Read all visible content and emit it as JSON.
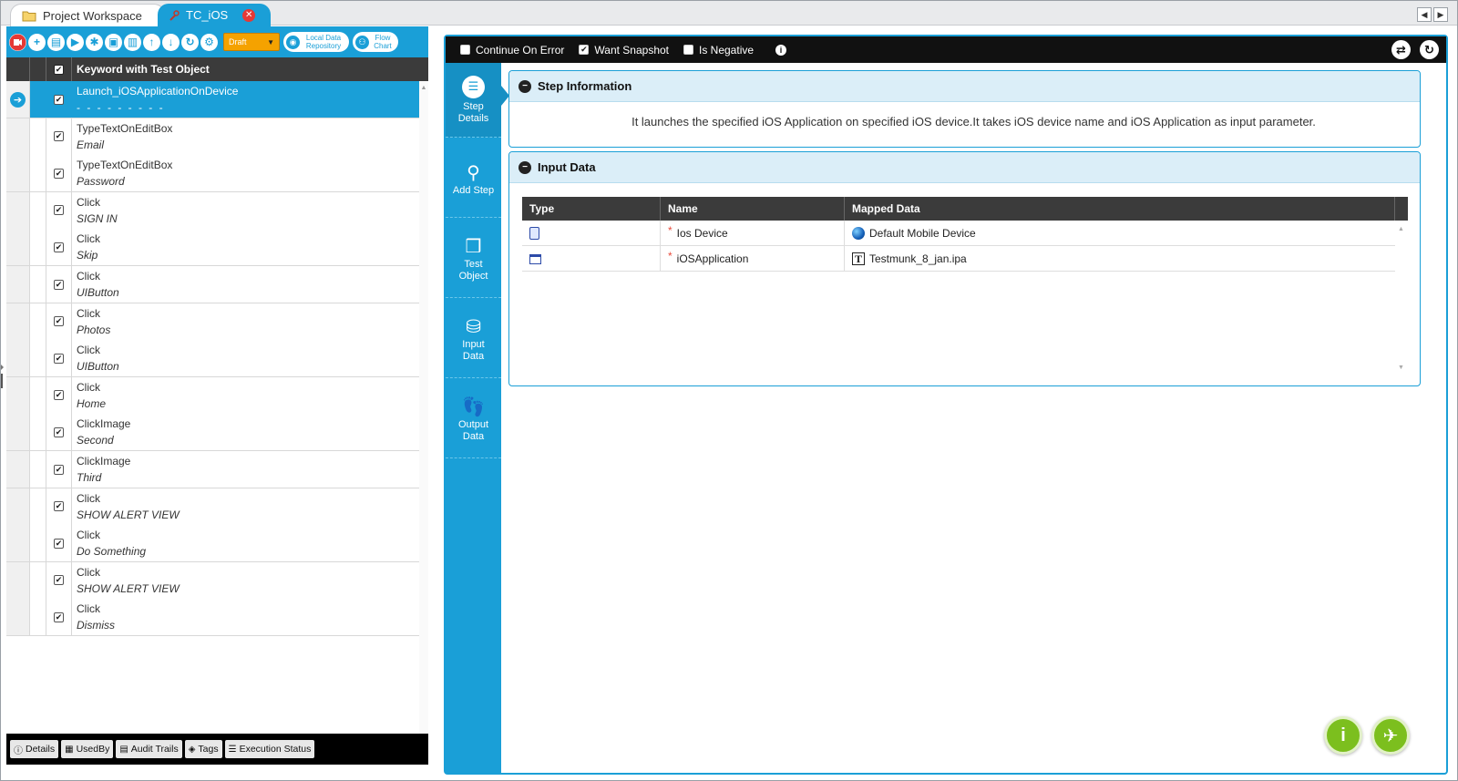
{
  "tabs": {
    "workspace": "Project Workspace",
    "testcase": "TC_iOS"
  },
  "toolbar": {
    "draft": "Draft",
    "local_data_repository": "Local Data Repository",
    "flow_chart": "Flow Chart"
  },
  "grid": {
    "header": "Keyword with Test Object",
    "rows": [
      {
        "keyword": "Launch_iOSApplicationOnDevice",
        "object": "- - - - - - - - -"
      },
      {
        "keyword": "TypeTextOnEditBox",
        "object": "Email"
      },
      {
        "keyword": "TypeTextOnEditBox",
        "object": "Password"
      },
      {
        "keyword": "Click",
        "object": "SIGN IN"
      },
      {
        "keyword": "Click",
        "object": "Skip"
      },
      {
        "keyword": "Click",
        "object": "UIButton"
      },
      {
        "keyword": "Click",
        "object": "Photos"
      },
      {
        "keyword": "Click",
        "object": "UIButton"
      },
      {
        "keyword": "Click",
        "object": "Home"
      },
      {
        "keyword": "ClickImage",
        "object": "Second"
      },
      {
        "keyword": "ClickImage",
        "object": "Third"
      },
      {
        "keyword": "Click",
        "object": "SHOW ALERT VIEW"
      },
      {
        "keyword": "Click",
        "object": "Do Something"
      },
      {
        "keyword": "Click",
        "object": "SHOW ALERT VIEW"
      },
      {
        "keyword": "Click",
        "object": "Dismiss"
      }
    ]
  },
  "bottombar": {
    "details": "Details",
    "usedby": "UsedBy",
    "audit_trails": "Audit Trails",
    "tags": "Tags",
    "execution_status": "Execution Status"
  },
  "options": {
    "continue_on_error": "Continue On Error",
    "want_snapshot": "Want Snapshot",
    "is_negative": "Is Negative"
  },
  "sidetabs": {
    "step_details": "Step Details",
    "add_step": "Add Step",
    "test_object": "Test Object",
    "input_data": "Input Data",
    "output_data": "Output Data"
  },
  "step_info": {
    "title": "Step Information",
    "description": "It launches the specified iOS Application on specified iOS device.It takes iOS device name and iOS Application as input parameter."
  },
  "input_data": {
    "title": "Input Data",
    "columns": [
      "Type",
      "Name",
      "Mapped Data"
    ],
    "rows": [
      {
        "name": "Ios Device",
        "mapped": "Default Mobile Device"
      },
      {
        "name": "iOSApplication",
        "mapped": "Testmunk_8_jan.ipa"
      }
    ]
  },
  "colors": {
    "accent": "#1a9fd7",
    "header_dark": "#3b3b3b",
    "draft": "#f5a200",
    "fab_green": "#7cbf1e"
  }
}
